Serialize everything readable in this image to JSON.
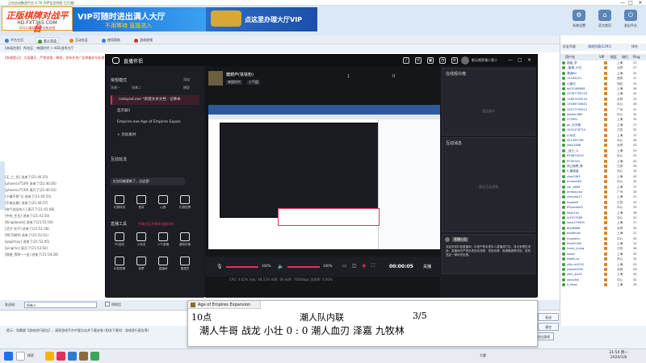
{
  "window": {
    "title": "正在启动聚游平台 4.76 (VIP会员特权 已开通)",
    "controls": [
      "—",
      "□",
      "✕"
    ]
  },
  "banner": {
    "logo_main": "正版棋牌对战平台",
    "logo_site": "HD.FXT365.COM",
    "logo_tag": "2013 精彩互动 全新启程",
    "vip_ad1_main": "VIP可随时进出满人大厅",
    "vip_ad1_sub": "不用等待 直接进入",
    "vip_ad2": "点这里办理大厅VIP",
    "toolbar": [
      {
        "label": "系统设置",
        "icon": "gear-icon",
        "glyph": "⚙"
      },
      {
        "label": "官方首页",
        "icon": "home-icon",
        "glyph": "⌂"
      },
      {
        "label": "君出平台",
        "icon": "exit-icon",
        "glyph": "⏻"
      }
    ]
  },
  "nav": [
    {
      "label": "平台主页",
      "color": "#3b7ad9"
    },
    {
      "label": "聊天频道",
      "color": "#2e9d3a"
    },
    {
      "label": "互动社区",
      "color": "#d98a1a"
    },
    {
      "label": "使用帮助",
      "color": "#3b7ad9"
    },
    {
      "label": "游戏视频",
      "color": "#c0392b"
    }
  ],
  "breadcrumb": "【本局信息】 所在区 : 帝国时代 > 4D1战术大厅",
  "notice": "【系统提示】 大局聊天，严禁违规、刷屏，发布任何广告将被封号处理",
  "chat_lines": [
    "[天_亡_忧] 进来了(21:40:25)",
    "[phoenix7539] 进来了(21:40:26)",
    "[phoenix7539] 离开了(21:40:54)",
    "[小蝶不想飞] 进来了(21:40:55)",
    "[不被允着] 进来了(21:40:57)",
    "[帝气创业的人] 离开了(21:41:08)",
    "[中的_生长] 进来了(21:41:50)",
    "[Kingsbowls] 进来了(21:51:00)",
    "[活力-先平] 进来了(21:51:38)",
    "[MC5889] 进来了(21:52:41)",
    "[psgirlsay] 进来了(21:52:45)",
    "[pingrlss] 离开了(21:53:02)",
    "[随便_等呀~~去] 进来了(21:54:28)"
  ],
  "send": {
    "label": "发送给:",
    "target": "所有人",
    "private_label": "悄悄话",
    "send_button": "发送",
    "clear_button": "清空"
  },
  "hint": "提示：如需要【游戏进行报告】，请到游戏平台中要点击并下载安装 (相关下载如：游戏进行报告等)",
  "bottom_buttons": [
    "游戏设置",
    "退出游戏"
  ],
  "right_panel": {
    "tabs": [
      "好友列表",
      "游戏列表(1291)",
      "排名"
    ],
    "header": [
      "用户名",
      "VIP",
      "地区",
      "排行",
      "Ping"
    ],
    "users": [
      {
        "name": "超级_学",
        "city": "上海",
        "ping": "25"
      },
      {
        "name": "_星魂_小白",
        "city": "大同",
        "ping": "37"
      },
      {
        "name": "潇洒lbt",
        "city": "上海",
        "ping": "42"
      },
      {
        "name": "12183221",
        "city": "西安",
        "ping": "31"
      },
      {
        "name": "小甜白",
        "city": "河北",
        "ping": "33"
      },
      {
        "name": "dc02186648",
        "city": "上海",
        "ping": "28"
      },
      {
        "name": "13787792224",
        "city": "上海",
        "ping": "44"
      },
      {
        "name": "13607493243",
        "city": "大同",
        "ping": "29"
      },
      {
        "name": "13006744641",
        "city": "中心",
        "ping": "36"
      },
      {
        "name": "13577793512",
        "city": "广州",
        "ping": "41"
      },
      {
        "name": "wishen369",
        "city": "中心",
        "ping": "30"
      },
      {
        "name": "273951",
        "city": "上海",
        "ping": "39"
      },
      {
        "name": "pk_天天情",
        "city": "上海",
        "ping": "27"
      },
      {
        "name": "1501476724",
        "city": "江苏",
        "ping": "35"
      },
      {
        "name": "小水花",
        "city": "上海",
        "ping": "25"
      },
      {
        "name": "421335706",
        "city": "中心",
        "ping": "38"
      },
      {
        "name": "ylwy1898",
        "city": "大同",
        "ping": "43"
      },
      {
        "name": "_战士_斗",
        "city": "上海",
        "ping": "29"
      },
      {
        "name": "ff20874245",
        "city": "中心",
        "ping": "32"
      },
      {
        "name": "ff230341",
        "city": "上海",
        "ping": "40"
      },
      {
        "name": "风云驰骋_黑",
        "city": "江苏",
        "ping": "26"
      },
      {
        "name": "ll_最强者",
        "city": "中心",
        "ping": "34"
      },
      {
        "name": "ulsa5383",
        "city": "上海",
        "ping": "45"
      },
      {
        "name": "munsra63",
        "city": "中心",
        "ping": "30"
      },
      {
        "name": "cpr_k808",
        "city": "上海",
        "ping": "37"
      },
      {
        "name": "amboyuxa",
        "city": "广州",
        "ping": "28"
      },
      {
        "name": "chayww17",
        "city": "上海",
        "ping": "41"
      },
      {
        "name": "fxqalw9",
        "city": "江苏",
        "ping": "33"
      },
      {
        "name": "ff5ysz4ea3",
        "city": "中心",
        "ping": "29"
      },
      {
        "name": "fwxp1a1",
        "city": "上海",
        "ping": "36"
      },
      {
        "name": "lu2017089",
        "city": "中心",
        "ping": "42"
      },
      {
        "name": "lwsu179509",
        "city": "上海",
        "ping": "27"
      },
      {
        "name": "bhjr8888",
        "city": "大同",
        "ping": "39"
      },
      {
        "name": "bxgtlmpx",
        "city": "上海",
        "ping": "31"
      },
      {
        "name": "huqjianlu",
        "city": "中心",
        "ping": "44"
      },
      {
        "name": "fhe0i2300",
        "city": "上海",
        "ping": "25"
      },
      {
        "name": "lcxxb_yujng",
        "city": "江苏",
        "ping": "38"
      },
      {
        "name": "wudu",
        "city": "上海",
        "ping": "30"
      },
      {
        "name": "ewdlt-cg",
        "city": "中心",
        "ping": "35"
      },
      {
        "name": "yilly-m2020",
        "city": "上海",
        "ping": "43"
      },
      {
        "name": "ywiow2020",
        "city": "大同",
        "ping": "28"
      },
      {
        "name": "zhm_sla32",
        "city": "上海",
        "ping": "34"
      },
      {
        "name": "yaqu3sk",
        "city": "中心",
        "ping": "40"
      },
      {
        "name": "ll_nhoo",
        "city": "上海",
        "ping": "26"
      }
    ]
  },
  "stream_app": {
    "title": "直播伴侣",
    "settings_label": "设置",
    "login_user": "影乐视界潮人第二",
    "scene_header": "常规模式",
    "scene_add": "添加",
    "scene_tabs": [
      "场景一",
      "场景二"
    ],
    "source_header": "横屏",
    "sources": [
      {
        "label": "notepad.exe *新建文本文档 - 记事本",
        "active": true
      },
      {
        "label": "显示器1",
        "active": false
      },
      {
        "label": "Empires.exe Age of Empires Expan",
        "active": false
      }
    ],
    "add_source": "+ 添加素材",
    "interact_header": "互动玩法",
    "interact_tip": "红包功能更新了，点这里!",
    "tools_row1": [
      "礼物特效",
      "音效",
      "心愿",
      "礼物投票"
    ],
    "live_tools_header": "直播工具",
    "live_tools_hint": "专属分区开播享流量扶持",
    "tools_row2": [
      "PK连线",
      "小玩法",
      "人气宝箱",
      "虚拟形象"
    ],
    "tools_row3": [
      "抖音剪辑",
      "投票",
      "直播间",
      "管理员"
    ],
    "room": {
      "name": "糖葫芦(铁铁粉)",
      "tag1": "帝国时代",
      "tag2": "人气值",
      "online": "1",
      "pending": "0"
    },
    "record": {
      "volume_mic": "100%",
      "volume_pc": "100%",
      "timer": "00:00:05",
      "end_button": "关播"
    },
    "status": "CPU: 4.62%  内存: 68.53%  帧率: 60  码率: 7000kbps  丢帧率: 0.00%",
    "right_head": "在线观众榜",
    "right_empty": "暂无观众",
    "msg_head": "互动消息",
    "msg_empty": "暂无互动消息",
    "notice_tag": "直播公告",
    "notice_text": "欢迎来到抖音直播间，抖音严禁未成年人直播或打赏，请大家理性消费，直播间内严禁出现违法违规、低俗色情、吸烟酗酒等内容，若有违反一律封号处理。"
  },
  "overlay": {
    "window_title": "Age of Empires Expansion",
    "round": "10点",
    "match": "潮人队内联",
    "score": "3/5",
    "line2": "潮人牛哥  战龙  小壮  0  :  0  潮人血刃  泽嘉  九牧林"
  },
  "taskbar": {
    "search": "搜索",
    "weather": "大雾",
    "time": "21:54 周一",
    "date": "2024/1/8"
  },
  "colors": {
    "accent": "#3b7ad9",
    "live_red": "#e0315a",
    "dark_bg": "#17181d"
  }
}
